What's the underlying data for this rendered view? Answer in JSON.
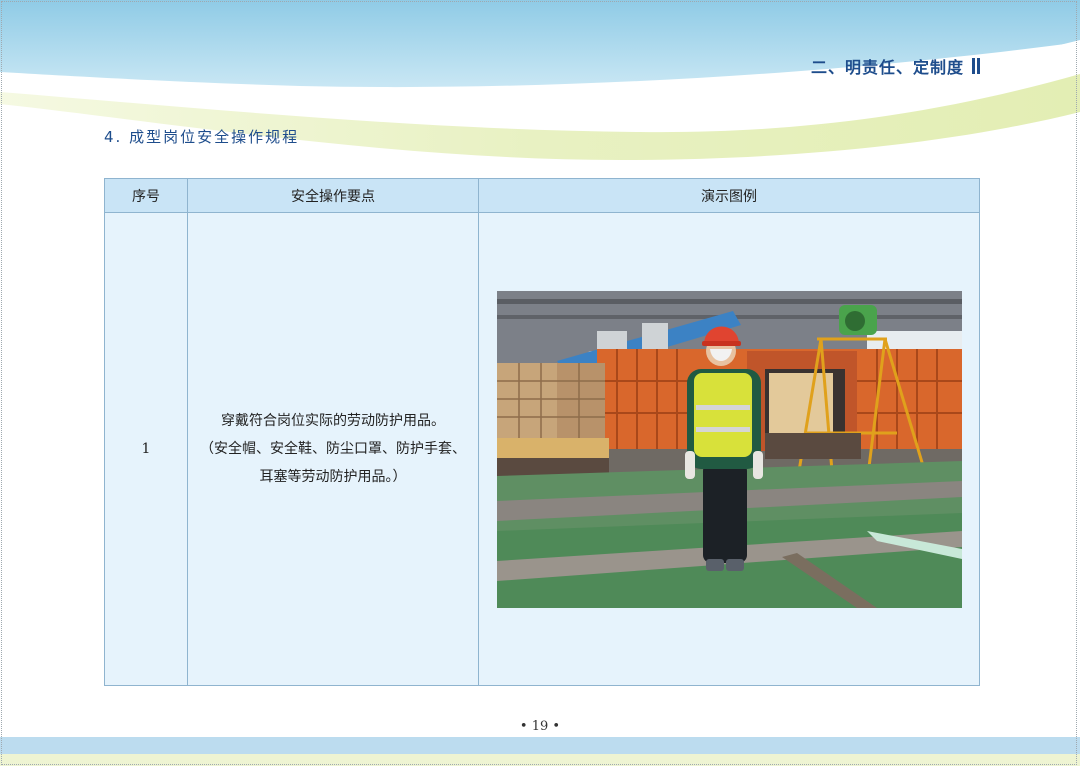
{
  "header": {
    "section_tag": "二、明责任、定制度"
  },
  "heading": "4. 成型岗位安全操作规程",
  "table": {
    "columns": [
      "序号",
      "安全操作要点",
      "演示图例"
    ],
    "rows": [
      {
        "num": "1",
        "desc_line1": "穿戴符合岗位实际的劳动防护用品。",
        "desc_line2": "（安全帽、安全鞋、防尘口罩、防护手套、",
        "desc_line3": "耳塞等劳动防护用品。）"
      }
    ]
  },
  "footer": {
    "page_number": "• 19 •"
  },
  "colors": {
    "accent": "#1e4d8c",
    "header_cell": "#c9e4f6",
    "body_cell": "#e6f3fc",
    "border": "#8fb4cf"
  }
}
